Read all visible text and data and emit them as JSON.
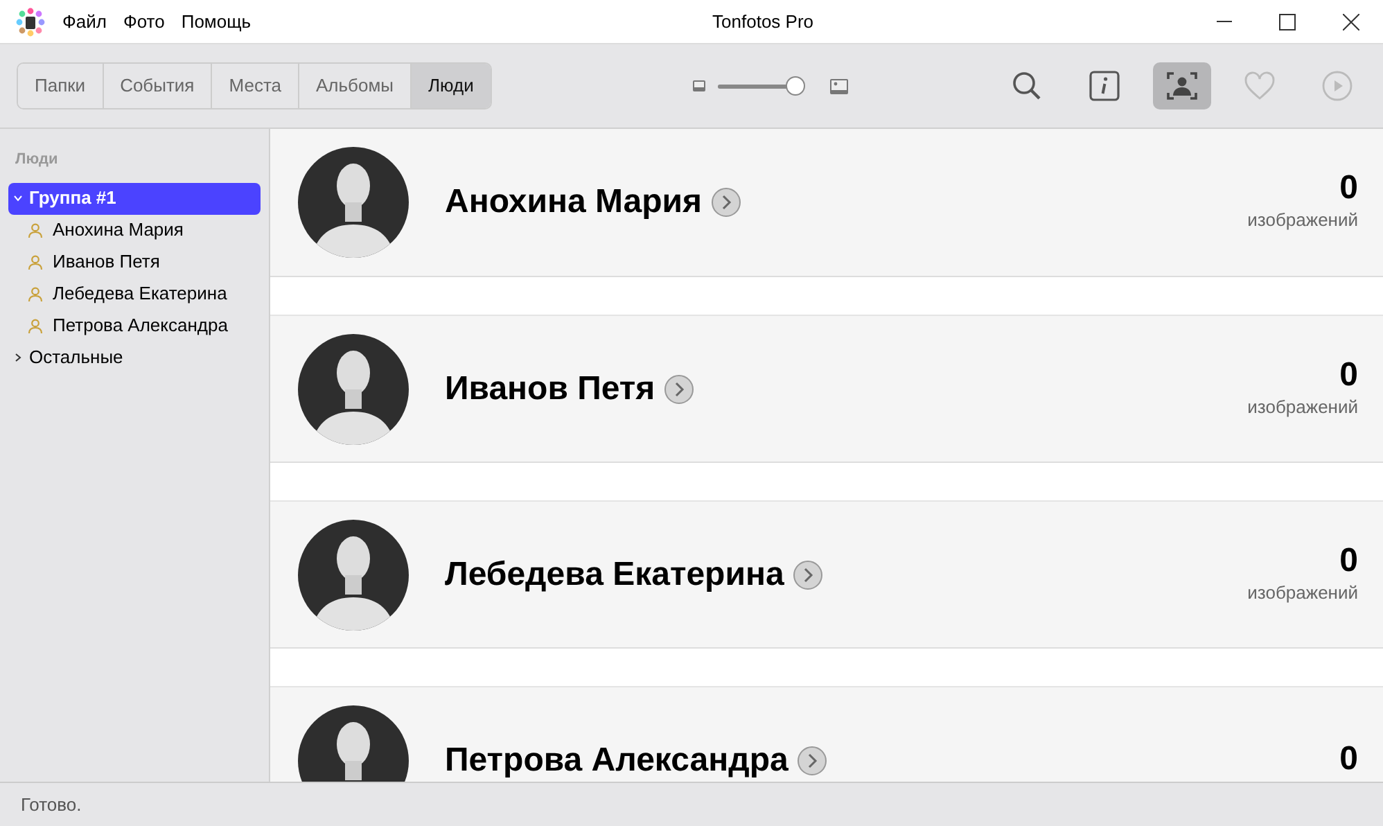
{
  "window": {
    "title": "Tonfotos Pro"
  },
  "menu": [
    "Файл",
    "Фото",
    "Помощь"
  ],
  "tabs": [
    {
      "label": "Папки",
      "selected": false
    },
    {
      "label": "События",
      "selected": false
    },
    {
      "label": "Места",
      "selected": false
    },
    {
      "label": "Альбомы",
      "selected": false
    },
    {
      "label": "Люди",
      "selected": true
    }
  ],
  "zoom_slider": {
    "level": 0.95
  },
  "tools": [
    {
      "kind": "search",
      "selected": false,
      "disabled": false
    },
    {
      "kind": "info",
      "selected": false,
      "disabled": false
    },
    {
      "kind": "faces",
      "selected": true,
      "disabled": false
    },
    {
      "kind": "favorite",
      "selected": false,
      "disabled": true
    },
    {
      "kind": "play",
      "selected": false,
      "disabled": true
    }
  ],
  "sidebar": {
    "heading": "Люди",
    "items": [
      {
        "label": "Группа #1",
        "expanded": true,
        "selected": true,
        "children": [
          {
            "label": "Анохина Мария",
            "selected": false
          },
          {
            "label": "Иванов Петя",
            "selected": false
          },
          {
            "label": "Лебедева Екатерина",
            "selected": false
          },
          {
            "label": "Петрова Александра",
            "selected": false
          }
        ]
      },
      {
        "label": "Остальные",
        "expanded": false,
        "selected": false
      }
    ]
  },
  "people": [
    {
      "name": "Анохина Мария",
      "count": "0",
      "caption": "изображений"
    },
    {
      "name": "Иванов Петя",
      "count": "0",
      "caption": "изображений"
    },
    {
      "name": "Лебедева Екатерина",
      "count": "0",
      "caption": "изображений"
    },
    {
      "name": "Петрова Александра",
      "count": "0"
    }
  ],
  "status_bar": "Готово."
}
